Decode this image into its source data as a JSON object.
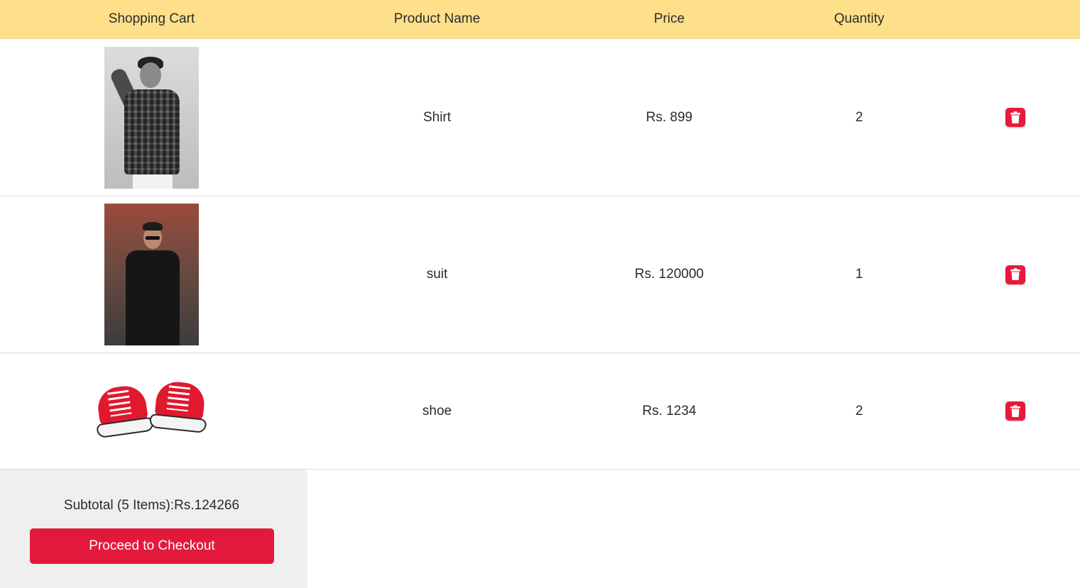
{
  "header": {
    "col_image": "Shopping Cart",
    "col_name": "Product Name",
    "col_price": "Price",
    "col_qty": "Quantity"
  },
  "items": [
    {
      "name": "Shirt",
      "price": "Rs. 899",
      "quantity": "2",
      "image_icon": "shirt-photo"
    },
    {
      "name": "suit",
      "price": "Rs. 120000",
      "quantity": "1",
      "image_icon": "suit-photo"
    },
    {
      "name": "shoe",
      "price": "Rs. 1234",
      "quantity": "2",
      "image_icon": "red-sneakers-photo"
    }
  ],
  "summary": {
    "subtotal": "Subtotal (5 Items):Rs.124266",
    "checkout_label": "Proceed to Checkout"
  },
  "colors": {
    "header_bg": "#ffe08a",
    "accent": "#e3193b",
    "summary_bg": "#efefef"
  },
  "icons": {
    "delete": "trash-icon"
  }
}
